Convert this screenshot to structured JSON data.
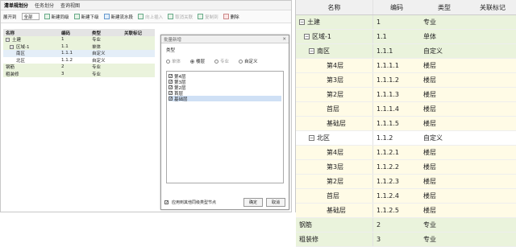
{
  "left_panel": {
    "tabs": [
      "清单规划分",
      "任务划分",
      "查询视图"
    ],
    "toolbar": {
      "scope_label": "展开到",
      "scope_value": "全部",
      "buttons": [
        "新建同级",
        "新建下级",
        "新建流水段",
        "向上插入",
        "取消关联",
        "复制到",
        "删除"
      ]
    },
    "table": {
      "headers": [
        "名称",
        "编码",
        "类型",
        "关联标记"
      ],
      "rows": [
        {
          "name": "土建",
          "code": "1",
          "type": "专业"
        },
        {
          "name": "区域-1",
          "code": "1.1",
          "type": "单体"
        },
        {
          "name": "南区",
          "code": "1.1.1",
          "type": "自定义"
        },
        {
          "name": "北区",
          "code": "1.1.2",
          "type": "自定义"
        },
        {
          "name": "钢筋",
          "code": "2",
          "type": "专业"
        },
        {
          "name": "粗装修",
          "code": "3",
          "type": "专业"
        }
      ]
    },
    "dialog": {
      "title": "批量新增",
      "type_label": "类型",
      "radio_options": [
        "单体",
        "楼层",
        "专业",
        "自定义"
      ],
      "floor_items": [
        "第4层",
        "第3层",
        "第2层",
        "首层",
        "基础层"
      ],
      "footer_checkbox": "应用到其他同级类型节点",
      "ok_label": "确定",
      "cancel_label": "取消"
    }
  },
  "right_panel": {
    "headers": [
      "名称",
      "编码",
      "类型",
      "关联标记"
    ],
    "rows": [
      {
        "name": "土建",
        "code": "1",
        "type": "专业",
        "toggle": "−",
        "style": "g"
      },
      {
        "name": "区域-1",
        "code": "1.1",
        "type": "单体",
        "toggle": "−",
        "style": "g"
      },
      {
        "name": "南区",
        "code": "1.1.1",
        "type": "自定义",
        "toggle": "−",
        "style": "g"
      },
      {
        "name": "第4层",
        "code": "1.1.1.1",
        "type": "楼层",
        "style": "y"
      },
      {
        "name": "第3层",
        "code": "1.1.1.2",
        "type": "楼层",
        "style": "y"
      },
      {
        "name": "第2层",
        "code": "1.1.1.3",
        "type": "楼层",
        "style": "y"
      },
      {
        "name": "首层",
        "code": "1.1.1.4",
        "type": "楼层",
        "style": "y"
      },
      {
        "name": "基础层",
        "code": "1.1.1.5",
        "type": "楼层",
        "style": "y"
      },
      {
        "name": "北区",
        "code": "1.1.2",
        "type": "自定义",
        "toggle": "−",
        "style": "w"
      },
      {
        "name": "第4层",
        "code": "1.1.2.1",
        "type": "楼层",
        "style": "y"
      },
      {
        "name": "第3层",
        "code": "1.1.2.2",
        "type": "楼层",
        "style": "y"
      },
      {
        "name": "第2层",
        "code": "1.1.2.3",
        "type": "楼层",
        "style": "y"
      },
      {
        "name": "首层",
        "code": "1.1.2.4",
        "type": "楼层",
        "style": "y"
      },
      {
        "name": "基础层",
        "code": "1.1.2.5",
        "type": "楼层",
        "style": "y"
      },
      {
        "name": "钢筋",
        "code": "2",
        "type": "专业",
        "style": "g"
      },
      {
        "name": "粗装修",
        "code": "3",
        "type": "专业",
        "style": "g"
      }
    ]
  }
}
